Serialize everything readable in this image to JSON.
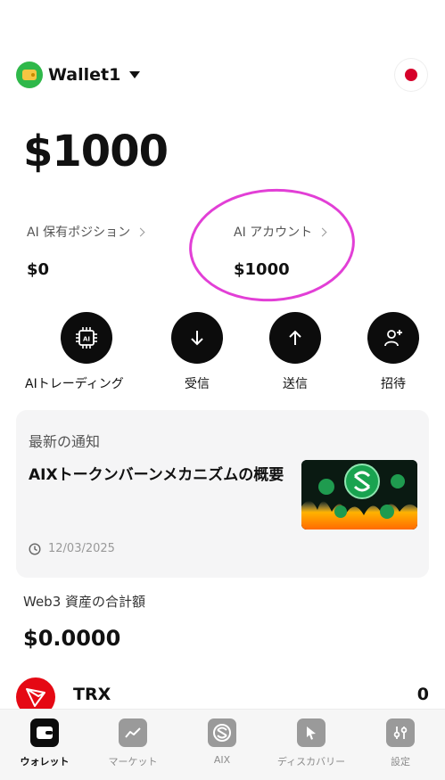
{
  "wallet": {
    "name": "Wallet1"
  },
  "balance": "$1000",
  "stats": {
    "ai_positions": {
      "label": "AI 保有ポジション",
      "value": "$0"
    },
    "ai_account": {
      "label": "AI アカウント",
      "value": "$1000"
    }
  },
  "actions": [
    {
      "label": "AIトレーディング",
      "icon": "ai-chip-icon"
    },
    {
      "label": "受信",
      "icon": "arrow-down-icon"
    },
    {
      "label": "送信",
      "icon": "arrow-up-icon"
    },
    {
      "label": "招待",
      "icon": "add-user-icon"
    }
  ],
  "notice": {
    "heading": "最新の通知",
    "title": "AIXトークンバーンメカニズムの概要",
    "date": "12/03/2025"
  },
  "web3": {
    "label": "Web3 資産の合計額",
    "value": "$0.0000"
  },
  "assets": [
    {
      "name": "TRX",
      "amount": "0"
    }
  ],
  "tabs": [
    {
      "label": "ウォレット",
      "icon": "wallet-icon",
      "active": true
    },
    {
      "label": "マーケット",
      "icon": "chart-icon",
      "active": false
    },
    {
      "label": "AIX",
      "icon": "aix-logo-icon",
      "active": false
    },
    {
      "label": "ディスカバリー",
      "icon": "cursor-icon",
      "active": false
    },
    {
      "label": "設定",
      "icon": "settings-icon",
      "active": false
    }
  ],
  "colors": {
    "highlight": "#e23fd6",
    "accent": "#0c0c0c",
    "trx": "#e50914"
  }
}
